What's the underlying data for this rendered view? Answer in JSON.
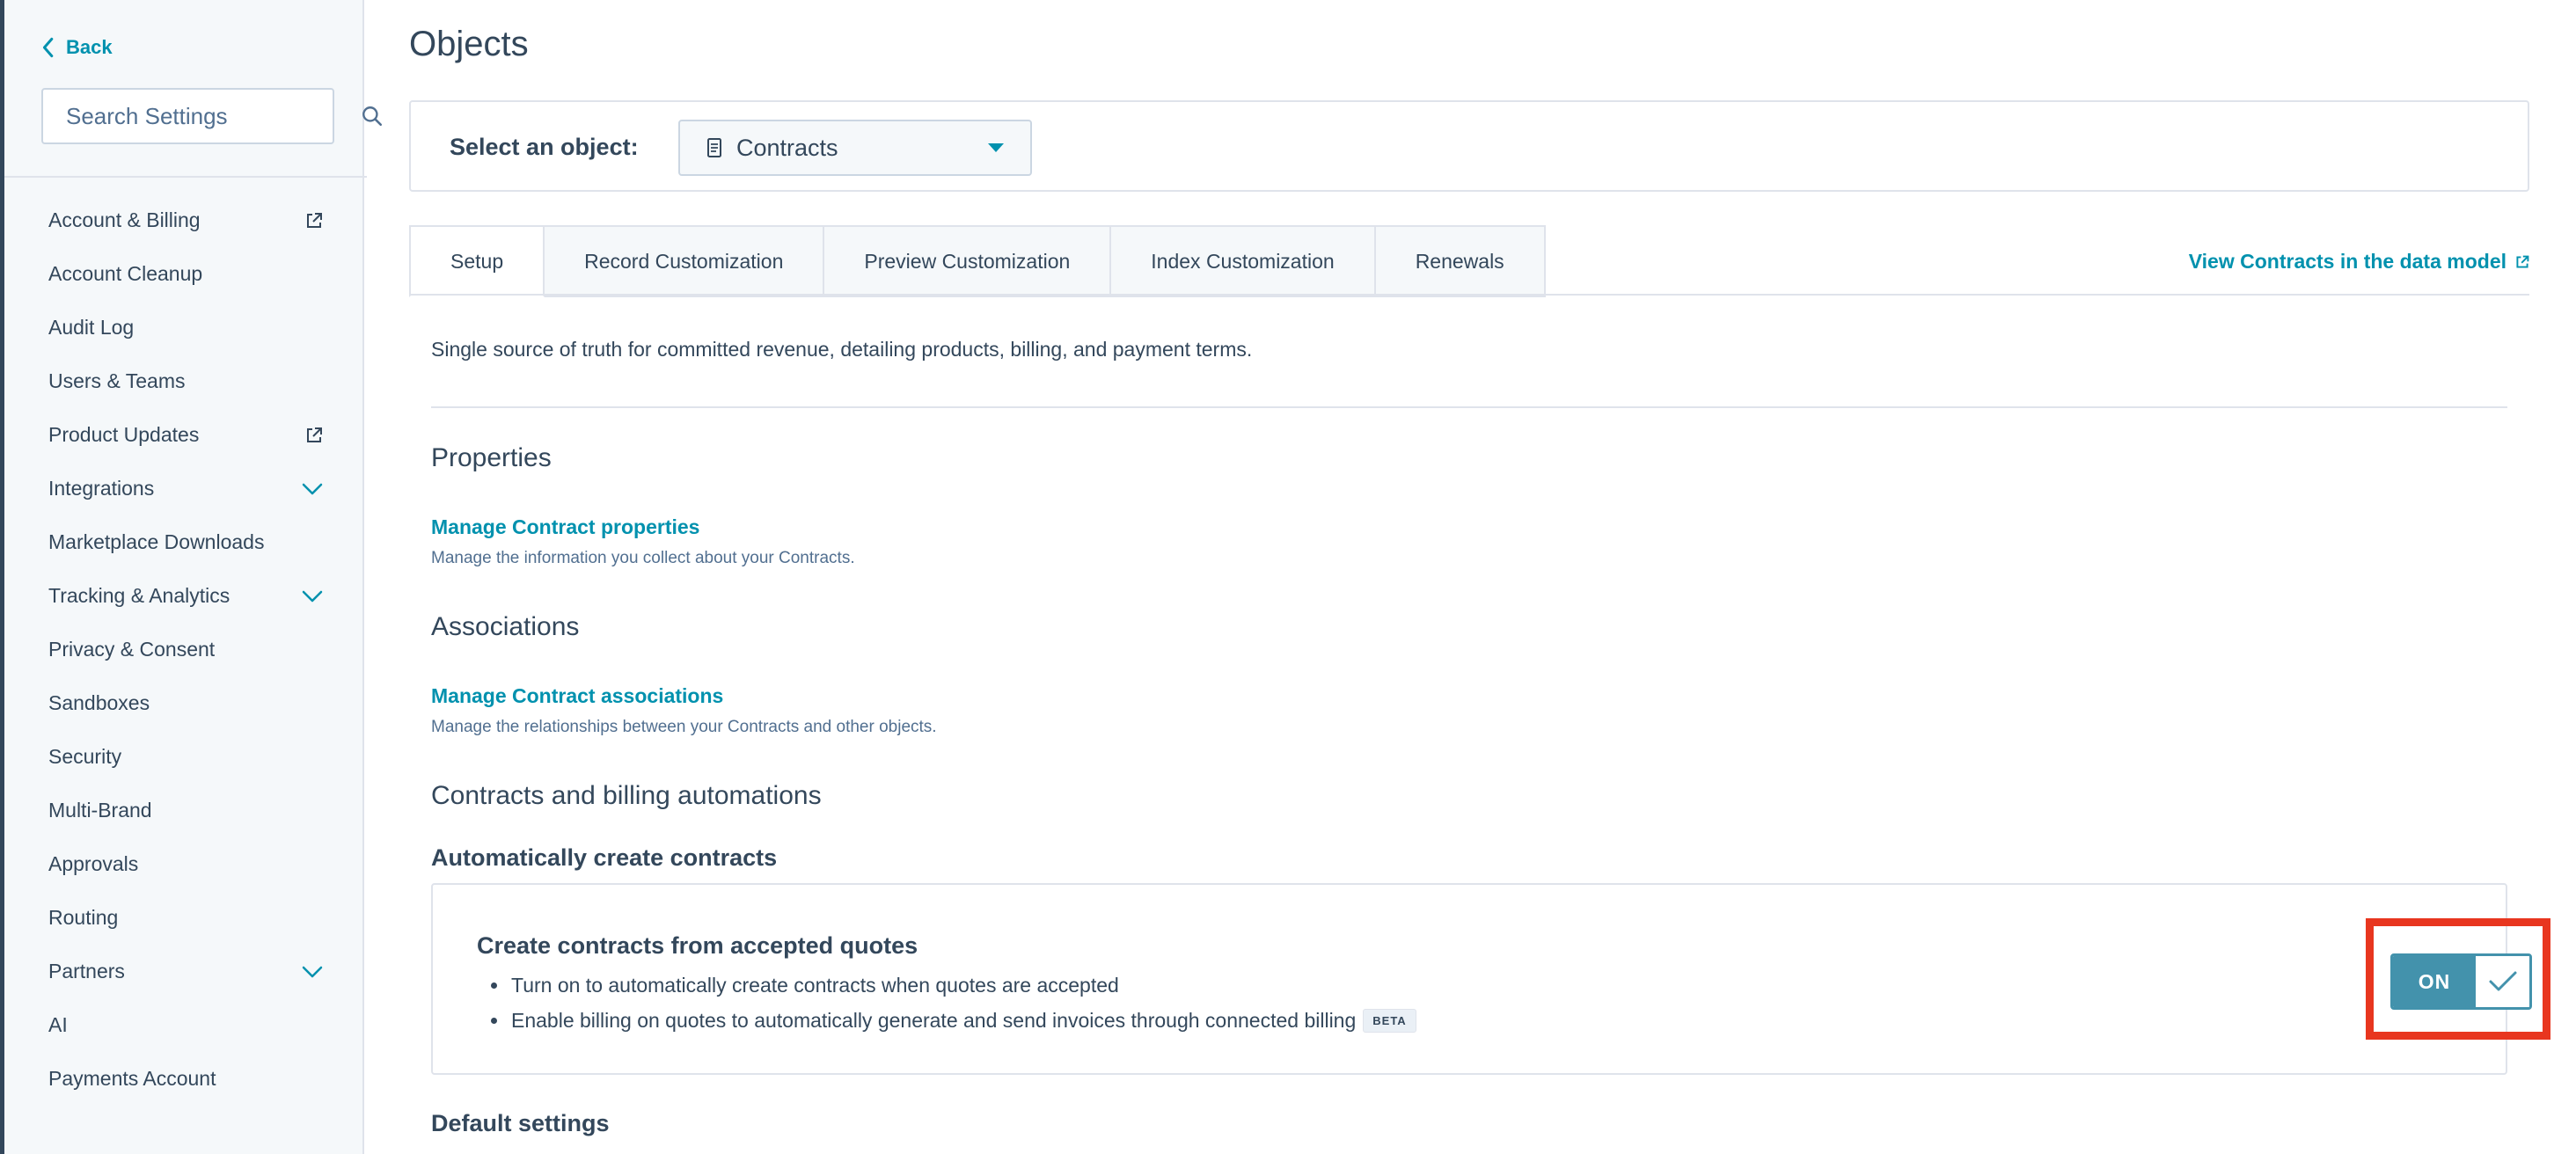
{
  "sidebar": {
    "back_label": "Back",
    "search_placeholder": "Search Settings",
    "items": [
      {
        "label": "Account & Billing",
        "icon": "external-link-icon"
      },
      {
        "label": "Account Cleanup",
        "icon": ""
      },
      {
        "label": "Audit Log",
        "icon": ""
      },
      {
        "label": "Users & Teams",
        "icon": ""
      },
      {
        "label": "Product Updates",
        "icon": "external-link-icon"
      },
      {
        "label": "Integrations",
        "icon": "chevron-down-icon"
      },
      {
        "label": "Marketplace Downloads",
        "icon": ""
      },
      {
        "label": "Tracking & Analytics",
        "icon": "chevron-down-icon"
      },
      {
        "label": "Privacy & Consent",
        "icon": ""
      },
      {
        "label": "Sandboxes",
        "icon": ""
      },
      {
        "label": "Security",
        "icon": ""
      },
      {
        "label": "Multi-Brand",
        "icon": ""
      },
      {
        "label": "Approvals",
        "icon": ""
      },
      {
        "label": "Routing",
        "icon": ""
      },
      {
        "label": "Partners",
        "icon": "chevron-down-icon"
      },
      {
        "label": "AI",
        "icon": ""
      },
      {
        "label": "Payments Account",
        "icon": ""
      }
    ]
  },
  "main": {
    "title": "Objects",
    "select_label": "Select an object:",
    "selected_object": "Contracts",
    "tabs": [
      {
        "label": "Setup",
        "active": true
      },
      {
        "label": "Record Customization",
        "active": false
      },
      {
        "label": "Preview Customization",
        "active": false
      },
      {
        "label": "Index Customization",
        "active": false
      },
      {
        "label": "Renewals",
        "active": false
      }
    ],
    "view_link": "View Contracts in the data model",
    "description": "Single source of truth for committed revenue, detailing products, billing, and payment terms.",
    "properties": {
      "heading": "Properties",
      "link": "Manage Contract properties",
      "help": "Manage the information you collect about your Contracts."
    },
    "associations": {
      "heading": "Associations",
      "link": "Manage Contract associations",
      "help": "Manage the relationships between your Contracts and other objects."
    },
    "automations": {
      "heading": "Contracts and billing automations",
      "subheading": "Automatically create contracts",
      "card_title": "Create contracts from accepted quotes",
      "bullets": [
        "Turn on to automatically create contracts when quotes are accepted",
        "Enable billing on quotes to automatically generate and send invoices through connected billing"
      ],
      "badge": "BETA",
      "toggle_label": "ON",
      "toggle_on": true
    },
    "default_settings_heading": "Default settings"
  },
  "colors": {
    "accent": "#0091ae",
    "text": "#33475b",
    "toggle": "#4392ac",
    "highlight": "#e8361f"
  }
}
